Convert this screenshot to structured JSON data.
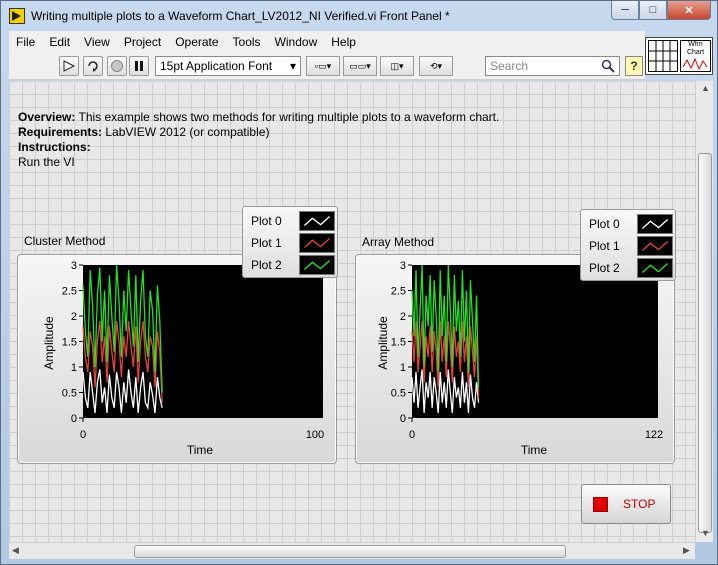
{
  "window": {
    "title": "Writing multiple plots to a Waveform Chart_LV2012_NI Verified.vi Front Panel *",
    "controls": {
      "minimize": "─",
      "maximize": "□",
      "close": "✕"
    }
  },
  "menu": [
    "File",
    "Edit",
    "View",
    "Project",
    "Operate",
    "Tools",
    "Window",
    "Help"
  ],
  "toolbar": {
    "font": "15pt Application Font",
    "search_placeholder": "Search",
    "help_label": "?"
  },
  "vi_icon": {
    "text": "Wfm Chart"
  },
  "description": {
    "overview_label": "Overview:",
    "overview_text": " This example shows two methods for writing multiple plots to a waveform chart.",
    "requirements_label": "Requirements:",
    "requirements_text": " LabVIEW 2012 (or compatible)",
    "instructions_label": "Instructions:",
    "instructions_text": "Run the VI"
  },
  "charts": [
    {
      "label": "Cluster Method",
      "xlabel": "Time",
      "ylabel": "Amplitude",
      "xmax_label": "100"
    },
    {
      "label": "Array Method",
      "xlabel": "Time",
      "ylabel": "Amplitude",
      "xmax_label": "122"
    }
  ],
  "legend": [
    "Plot 0",
    "Plot 1",
    "Plot 2"
  ],
  "colors": {
    "plot0": "#ffffff",
    "plot1": "#e84040",
    "plot2": "#22e022",
    "plot_bg": "#000000"
  },
  "stop_button": {
    "label": "STOP"
  },
  "chart_data": [
    {
      "type": "line",
      "title": "Cluster Method",
      "xlabel": "Time",
      "ylabel": "Amplitude",
      "xlim": [
        0,
        100
      ],
      "ylim": [
        0,
        3
      ],
      "yticks": [
        0,
        0.5,
        1,
        1.5,
        2,
        2.5,
        3
      ],
      "xticks": [
        0,
        100
      ],
      "legend_position": "top-right",
      "series": [
        {
          "name": "Plot 0",
          "values": [
            0.9,
            0.4,
            0.2,
            0.9,
            0.5,
            0.1,
            0.7,
            0.95,
            0.3,
            0.6,
            0.1,
            0.85,
            0.4,
            0.2,
            0.9,
            0.6,
            0.1,
            0.7,
            0.3,
            0.95,
            0.5,
            0.2,
            0.8,
            0.1,
            0.6,
            0.9,
            0.3,
            0.2,
            0.7,
            0.45,
            0.1,
            0.8,
            0.4,
            0.2
          ]
        },
        {
          "name": "Plot 1",
          "values": [
            1.8,
            1.2,
            0.9,
            1.7,
            1.4,
            0.6,
            1.5,
            1.9,
            1.1,
            1.6,
            0.7,
            1.8,
            1.3,
            0.9,
            1.9,
            1.5,
            0.8,
            1.6,
            1.2,
            1.9,
            1.4,
            1.0,
            1.8,
            0.7,
            1.5,
            1.9,
            1.2,
            0.9,
            1.6,
            1.4,
            0.6,
            1.7,
            1.3,
            0.3
          ]
        },
        {
          "name": "Plot 2",
          "values": [
            2.6,
            1.7,
            1.2,
            2.9,
            2.2,
            1.0,
            2.4,
            2.95,
            1.5,
            2.5,
            1.1,
            2.8,
            2.0,
            1.3,
            3.0,
            2.3,
            1.2,
            2.5,
            1.7,
            2.9,
            2.1,
            1.4,
            2.8,
            1.1,
            2.3,
            2.9,
            1.6,
            1.2,
            2.5,
            2.1,
            0.9,
            2.6,
            1.9,
            0.5
          ]
        }
      ]
    },
    {
      "type": "line",
      "title": "Array Method",
      "xlabel": "Time",
      "ylabel": "Amplitude",
      "xlim": [
        0,
        122
      ],
      "ylim": [
        0,
        3
      ],
      "yticks": [
        0,
        0.5,
        1,
        1.5,
        2,
        2.5,
        3
      ],
      "xticks": [
        0,
        122
      ],
      "legend_position": "top-right",
      "series": [
        {
          "name": "Plot 0",
          "values": [
            0.8,
            0.3,
            0.9,
            0.2,
            0.6,
            0.95,
            0.1,
            0.7,
            0.4,
            0.9,
            0.2,
            0.8,
            0.5,
            0.1,
            0.9,
            0.3,
            0.7,
            0.2,
            0.95,
            0.5,
            0.1,
            0.8,
            0.4,
            0.6,
            0.2,
            0.9,
            0.3,
            0.7,
            0.1,
            0.85,
            0.4,
            0.2,
            0.7,
            0.3
          ]
        },
        {
          "name": "Plot 1",
          "values": [
            1.7,
            1.1,
            1.9,
            0.9,
            1.4,
            1.9,
            0.7,
            1.6,
            1.2,
            1.8,
            0.9,
            1.7,
            1.3,
            0.6,
            1.9,
            1.1,
            1.6,
            0.8,
            1.9,
            1.4,
            0.7,
            1.8,
            1.2,
            1.5,
            0.9,
            1.9,
            1.1,
            1.6,
            0.6,
            1.8,
            1.3,
            0.8,
            1.6,
            0.4
          ]
        },
        {
          "name": "Plot 2",
          "values": [
            2.5,
            1.6,
            2.9,
            1.2,
            2.1,
            3.0,
            1.0,
            2.4,
            1.8,
            2.8,
            1.3,
            2.7,
            2.0,
            0.9,
            2.9,
            1.6,
            2.4,
            1.1,
            3.0,
            2.1,
            1.0,
            2.8,
            1.7,
            2.3,
            1.2,
            2.9,
            1.5,
            2.5,
            0.9,
            2.7,
            1.9,
            1.1,
            2.4,
            0.6
          ]
        }
      ]
    }
  ]
}
